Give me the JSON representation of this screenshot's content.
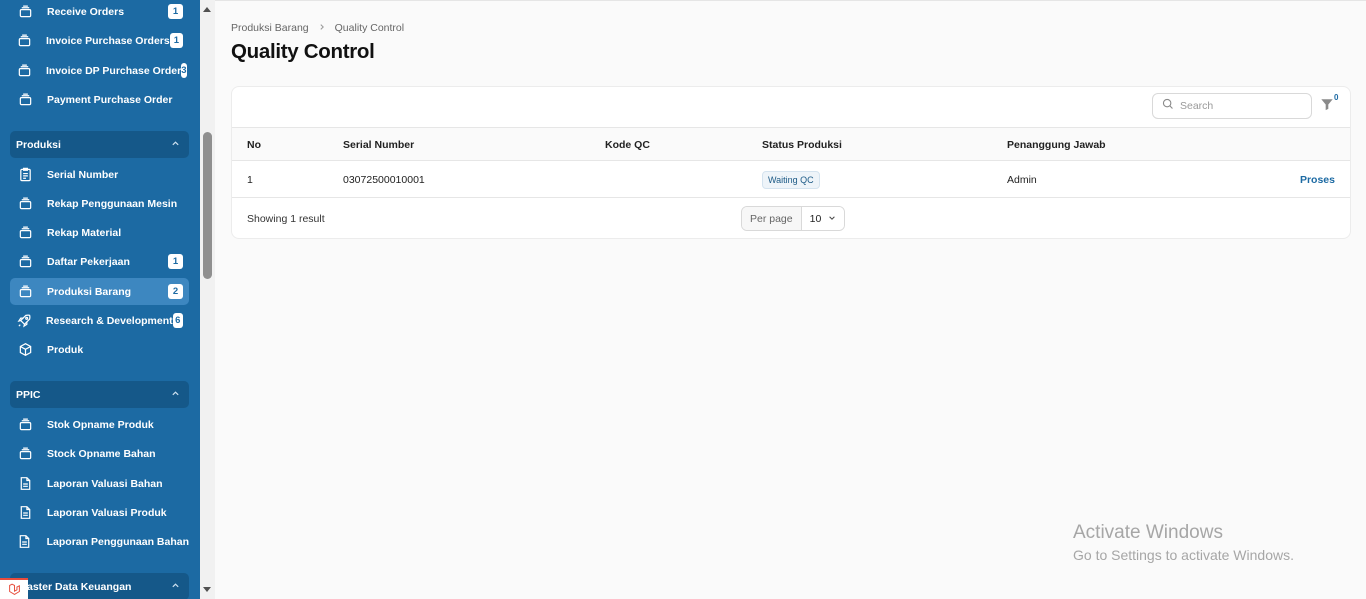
{
  "sidebar": {
    "items": [
      {
        "label": "Receive Orders",
        "badge": "1",
        "icon": "stack-icon"
      },
      {
        "label": "Invoice Purchase Orders",
        "badge": "1",
        "icon": "stack-icon"
      },
      {
        "label": "Invoice DP Purchase Order",
        "badge": "3",
        "icon": "stack-icon"
      },
      {
        "label": "Payment Purchase Order",
        "badge": "",
        "icon": "stack-icon"
      }
    ],
    "groups": [
      {
        "title": "Produksi",
        "items": [
          {
            "label": "Serial Number",
            "badge": "",
            "icon": "clipboard-icon"
          },
          {
            "label": "Rekap Penggunaan Mesin",
            "badge": "",
            "icon": "stack-icon"
          },
          {
            "label": "Rekap Material",
            "badge": "",
            "icon": "stack-icon"
          },
          {
            "label": "Daftar Pekerjaan",
            "badge": "1",
            "icon": "stack-icon"
          },
          {
            "label": "Produksi Barang",
            "badge": "2",
            "icon": "stack-icon",
            "active": true
          },
          {
            "label": "Research & Development",
            "badge": "6",
            "icon": "rocket-icon"
          },
          {
            "label": "Produk",
            "badge": "",
            "icon": "cube-icon"
          }
        ]
      },
      {
        "title": "PPIC",
        "items": [
          {
            "label": "Stok Opname Produk",
            "badge": "",
            "icon": "stack-icon"
          },
          {
            "label": "Stock Opname Bahan",
            "badge": "",
            "icon": "stack-icon"
          },
          {
            "label": "Laporan Valuasi Bahan",
            "badge": "",
            "icon": "document-icon"
          },
          {
            "label": "Laporan Valuasi Produk",
            "badge": "",
            "icon": "document-icon"
          },
          {
            "label": "Laporan Penggunaan Bahan",
            "badge": "",
            "icon": "document-icon"
          }
        ]
      },
      {
        "title": "aster Data Keuangan",
        "items": []
      }
    ]
  },
  "breadcrumb": {
    "parent": "Produksi Barang",
    "current": "Quality Control"
  },
  "page": {
    "title": "Quality Control"
  },
  "toolbar": {
    "search_placeholder": "Search",
    "filter_count": "0"
  },
  "table": {
    "columns": [
      "No",
      "Serial Number",
      "Kode QC",
      "Status Produksi",
      "Penanggung Jawab"
    ],
    "rows": [
      {
        "no": "1",
        "serial": "03072500010001",
        "kode_qc": "",
        "status": "Waiting QC",
        "pj": "Admin",
        "action": "Proses"
      }
    ]
  },
  "footer": {
    "showing": "Showing 1 result",
    "per_page_label": "Per page",
    "per_page_value": "10"
  },
  "watermark": {
    "line1": "Activate Windows",
    "line2": "Go to Settings to activate Windows."
  },
  "colors": {
    "sidebar_bg": "#1c6aa3",
    "sidebar_active": "#3d87c0",
    "group_header": "#155889",
    "accent": "#1c6aa3"
  }
}
